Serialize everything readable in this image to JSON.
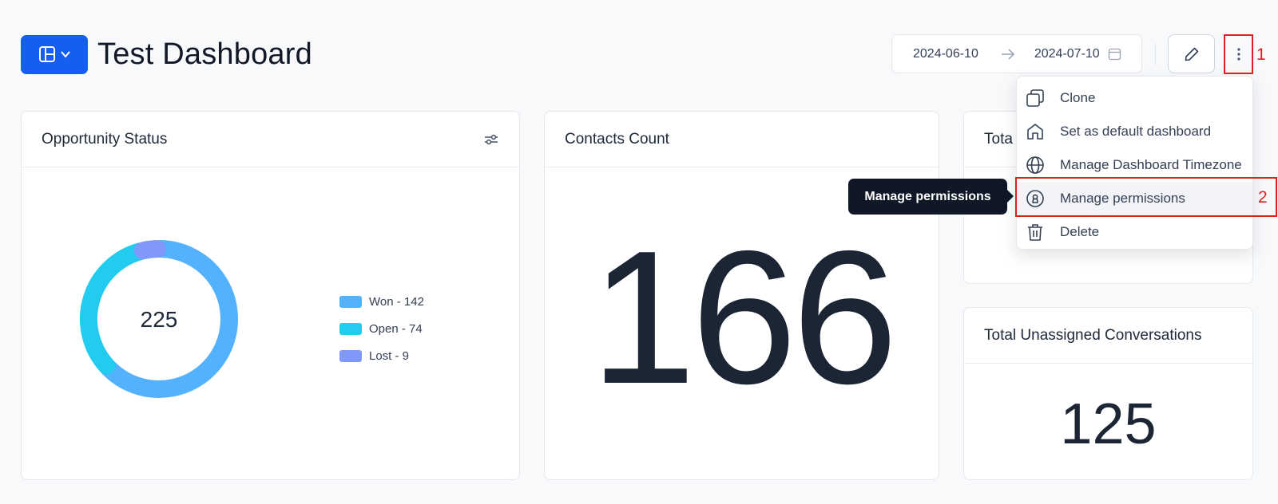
{
  "header": {
    "title": "Test Dashboard",
    "date_start": "2024-06-10",
    "date_end": "2024-07-10"
  },
  "annotations": {
    "mark1": "1",
    "mark2": "2"
  },
  "menu": {
    "items": [
      {
        "label": "Clone",
        "icon": "clone-icon"
      },
      {
        "label": "Set as default dashboard",
        "icon": "home-icon"
      },
      {
        "label": "Manage Dashboard Timezone",
        "icon": "globe-icon"
      },
      {
        "label": "Manage permissions",
        "icon": "lock-circle-icon"
      },
      {
        "label": "Delete",
        "icon": "trash-icon"
      }
    ]
  },
  "tooltip": "Manage permissions",
  "cards": {
    "opportunity": {
      "title": "Opportunity Status",
      "total": "225"
    },
    "contacts": {
      "title": "Contacts Count",
      "value": "166"
    },
    "total_partial": {
      "title": "Tota"
    },
    "unassigned": {
      "title": "Total Unassigned Conversations",
      "value": "125"
    }
  },
  "chart_data": {
    "type": "pie",
    "categories": [
      "Won",
      "Open",
      "Lost"
    ],
    "values": [
      142,
      74,
      9
    ],
    "legend": [
      "Won - 142",
      "Open - 74",
      "Lost - 9"
    ],
    "center_label": "225",
    "colors": [
      "#53b1fd",
      "#22ccee",
      "#8098f9"
    ]
  },
  "colors": {
    "primary": "#155eef",
    "annotation": "#e02020"
  }
}
